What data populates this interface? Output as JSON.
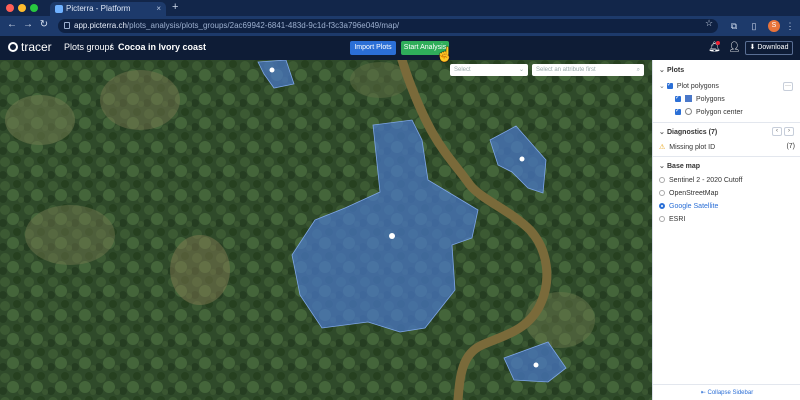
{
  "browser": {
    "tab_title": "Picterra - Platform",
    "tab_close": "×",
    "new_tab": "+",
    "back": "←",
    "forward": "→",
    "reload": "↻",
    "url_host": "app.picterra.ch",
    "url_path": "/plots_analysis/plots_groups/2ac69942-6841-483d-9c1d-f3c3a796e049/map/",
    "profile_initial": "S",
    "traffic_colors": [
      "#ff5f57",
      "#febc2e",
      "#28c840"
    ]
  },
  "header": {
    "logo_text": "tracer",
    "breadcrumb_root": "Plots groups",
    "breadcrumb_sep": "/",
    "breadcrumb_current": "Cocoa in Ivory coast",
    "import_plots_label": "Import Plots",
    "start_analysis_label": "Start Analysis",
    "download_label": "⬇ Download"
  },
  "map": {
    "select_placeholder": "Select",
    "attribute_placeholder": "Select an attribute first"
  },
  "sidebar": {
    "plots_title": "Plots",
    "plot_polygons": "Plot polygons",
    "polygons": "Polygons",
    "polygon_center": "Polygon center",
    "more_btn": "···",
    "diagnostics_title": "Diagnostics (7)",
    "missing_plot_id": "Missing plot ID",
    "missing_count": "(7)",
    "basemap_title": "Base map",
    "basemaps": [
      "Sentinel 2 - 2020 Cutoff",
      "OpenStreetMap",
      "Google Satellite",
      "ESRI"
    ],
    "selected_basemap": "Google Satellite",
    "collapse_label": "⇤ Collapse Sidebar"
  },
  "colors": {
    "accent_blue": "#2b6fd6",
    "start_green": "#2fae5a",
    "polygon_fill": "#4a78c9",
    "river": "#7a6a3a"
  }
}
